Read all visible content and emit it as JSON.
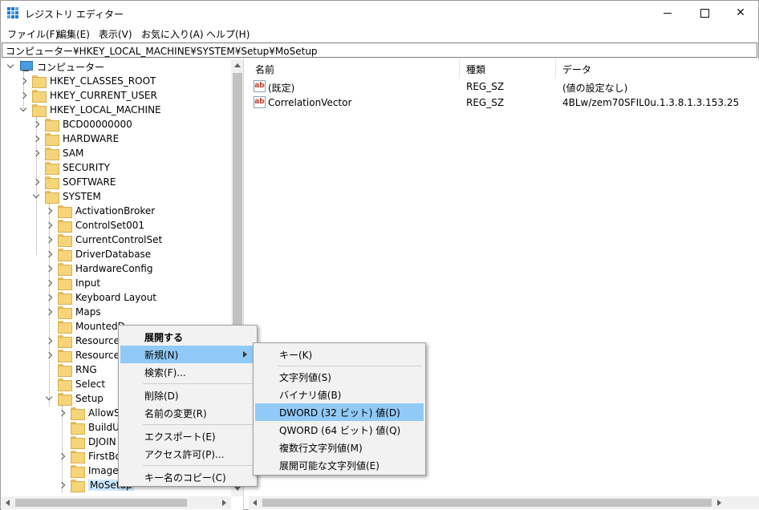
{
  "window": {
    "title": "レジストリ エディター",
    "minimize": "minimize",
    "maximize": "maximize",
    "close": "✕"
  },
  "menu": [
    "ファイル(F)",
    "編集(E)",
    "表示(V)",
    "お気に入り(A)",
    "ヘルプ(H)"
  ],
  "address": "コンピューター¥HKEY_LOCAL_MACHINE¥SYSTEM¥Setup¥MoSetup",
  "tree": {
    "root": "コンピューター",
    "hives": [
      "HKEY_CLASSES_ROOT",
      "HKEY_CURRENT_USER",
      "HKEY_LOCAL_MACHINE"
    ],
    "hklm_children": [
      "BCD00000000",
      "HARDWARE",
      "SAM",
      "SECURITY",
      "SOFTWARE",
      "SYSTEM"
    ],
    "system_children": [
      "ActivationBroker",
      "ControlSet001",
      "CurrentControlSet",
      "DriverDatabase",
      "HardwareConfig",
      "Input",
      "Keyboard Layout",
      "Maps",
      "MountedD",
      "ResourceM",
      "ResourceP",
      "RNG",
      "Select",
      "Setup"
    ],
    "setup_children": [
      "AllowSt",
      "BuildUp",
      "DJOIN",
      "FirstBoo",
      "Image E",
      "MoSetup"
    ]
  },
  "values": {
    "columns": [
      "名前",
      "種類",
      "データ"
    ],
    "rows": [
      {
        "name": "(既定)",
        "type": "REG_SZ",
        "data": "(値の設定なし)"
      },
      {
        "name": "CorrelationVector",
        "type": "REG_SZ",
        "data": "4BLw/zem70SFIL0u.1.3.8.1.3.153.25"
      }
    ],
    "icon_text": "ab"
  },
  "context_menu": {
    "items": [
      "展開する",
      "新規(N)",
      "検索(F)...",
      "削除(D)",
      "名前の変更(R)",
      "エクスポート(E)",
      "アクセス許可(P)...",
      "キー名のコピー(C)"
    ]
  },
  "submenu": {
    "items": [
      "キー(K)",
      "文字列値(S)",
      "バイナリ値(B)",
      "DWORD (32 ビット) 値(D)",
      "QWORD (64 ビット) 値(Q)",
      "複数行文字列値(M)",
      "展開可能な文字列値(E)"
    ]
  },
  "colors": {
    "selection": "#cce8ff",
    "menu_highlight": "#91c9f7",
    "folder": "#f5d47a"
  }
}
